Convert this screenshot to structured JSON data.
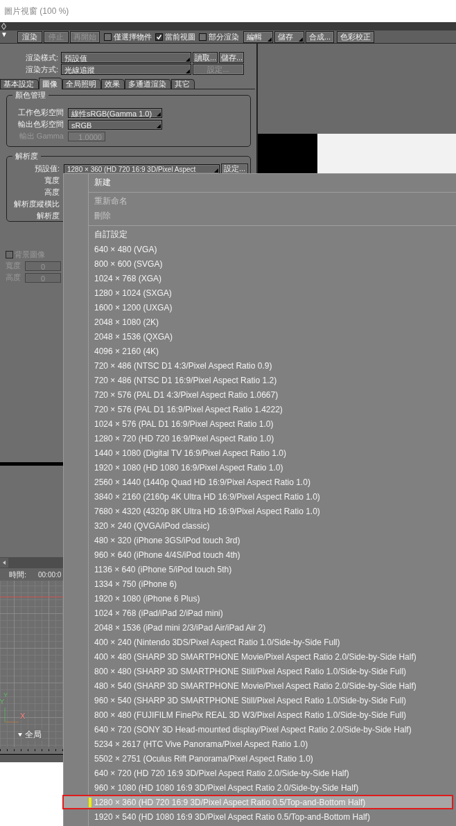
{
  "window": {
    "title": "圖片視窗 (100 %)"
  },
  "toolbar": {
    "collapse_glyph": "▼",
    "items": [
      {
        "kind": "button",
        "label": "渲染",
        "disabled": false
      },
      {
        "kind": "button",
        "label": "停止",
        "disabled": true
      },
      {
        "kind": "button",
        "label": "再開始",
        "disabled": true
      },
      {
        "kind": "checkbox",
        "label": "僅選擇物件",
        "checked": false,
        "disabled": false
      },
      {
        "kind": "checkbox",
        "label": "當前視圖",
        "checked": true,
        "disabled": false
      },
      {
        "kind": "checkbox",
        "label": "部分渲染",
        "checked": false,
        "disabled": false
      },
      {
        "kind": "dropdown",
        "label": "編輯",
        "disabled": false
      },
      {
        "kind": "dropdown",
        "label": "儲存",
        "disabled": false
      },
      {
        "kind": "button",
        "label": "合成...",
        "disabled": false
      },
      {
        "kind": "button",
        "label": "色彩校正",
        "disabled": false
      }
    ]
  },
  "render_settings": [
    {
      "label": "渲染樣式:",
      "value": "預設值",
      "buttons": [
        {
          "label": "讀取...",
          "disabled": false
        },
        {
          "label": "儲存...",
          "disabled": false
        }
      ]
    },
    {
      "label": "渲染方式:",
      "value": "光線追蹤",
      "buttons": [
        {
          "label": "設定...",
          "disabled": true
        }
      ]
    }
  ],
  "tabs": [
    {
      "label": "基本設定",
      "selected": false
    },
    {
      "label": "圖像",
      "selected": true
    },
    {
      "label": "全局照明",
      "selected": false
    },
    {
      "label": "效果",
      "selected": false
    },
    {
      "label": "多通道渲染",
      "selected": false
    },
    {
      "label": "其它",
      "selected": false
    }
  ],
  "color_management": {
    "title": "顏色管理",
    "rows": [
      {
        "kind": "dropdown",
        "label": "工作色彩空間",
        "value": "線性sRGB(Gamma 1.0)",
        "disabled": false
      },
      {
        "kind": "dropdown",
        "label": "輸出色彩空間",
        "value": "sRGB",
        "disabled": false
      },
      {
        "kind": "field",
        "label": "輸出 Gamma",
        "value": "1.0000",
        "disabled": true
      }
    ]
  },
  "resolution": {
    "title": "解析度",
    "preset": {
      "label": "預設值:",
      "value": "1280 × 360 (HD 720 16:9 3D/Pixel Aspect",
      "button": "設定..."
    },
    "labels": [
      "寬度",
      "高度",
      "解析度縱橫比",
      "解析度"
    ]
  },
  "background_image": {
    "label": "背景圖像",
    "checked": false,
    "disabled": true,
    "fields": [
      {
        "label": "寬度",
        "value": "0"
      },
      {
        "label": "高度",
        "value": "0"
      }
    ]
  },
  "timeline": {
    "time_label": "時間:",
    "time_value": "00:00:0",
    "axis_y": "Y",
    "axis_x": "X",
    "view_label": "全局"
  },
  "menu": {
    "items": [
      {
        "kind": "command",
        "label": "新建",
        "disabled": false,
        "selected": false
      },
      {
        "kind": "separator"
      },
      {
        "kind": "command",
        "label": "重新命名",
        "disabled": true,
        "selected": false
      },
      {
        "kind": "command",
        "label": "刪除",
        "disabled": true,
        "selected": false
      },
      {
        "kind": "separator"
      },
      {
        "kind": "command",
        "label": "自訂設定",
        "disabled": false,
        "selected": false
      },
      {
        "kind": "command",
        "label": "640 × 480 (VGA)",
        "disabled": false,
        "selected": false
      },
      {
        "kind": "command",
        "label": "800 × 600 (SVGA)",
        "disabled": false,
        "selected": false
      },
      {
        "kind": "command",
        "label": "1024 × 768 (XGA)",
        "disabled": false,
        "selected": false
      },
      {
        "kind": "command",
        "label": "1280 × 1024 (SXGA)",
        "disabled": false,
        "selected": false
      },
      {
        "kind": "command",
        "label": "1600 × 1200 (UXGA)",
        "disabled": false,
        "selected": false
      },
      {
        "kind": "command",
        "label": "2048 × 1080 (2K)",
        "disabled": false,
        "selected": false
      },
      {
        "kind": "command",
        "label": "2048 × 1536 (QXGA)",
        "disabled": false,
        "selected": false
      },
      {
        "kind": "command",
        "label": "4096 × 2160 (4K)",
        "disabled": false,
        "selected": false
      },
      {
        "kind": "command",
        "label": "720 × 486 (NTSC D1 4:3/Pixel Aspect Ratio 0.9)",
        "disabled": false,
        "selected": false
      },
      {
        "kind": "command",
        "label": "720 × 486 (NTSC D1 16:9/Pixel Aspect Ratio 1.2)",
        "disabled": false,
        "selected": false
      },
      {
        "kind": "command",
        "label": "720 × 576 (PAL D1 4:3/Pixel Aspect Ratio 1.0667)",
        "disabled": false,
        "selected": false
      },
      {
        "kind": "command",
        "label": "720 × 576 (PAL D1 16:9/Pixel Aspect Ratio 1.4222)",
        "disabled": false,
        "selected": false
      },
      {
        "kind": "command",
        "label": "1024 × 576 (PAL D1 16:9/Pixel Aspect Ratio 1.0)",
        "disabled": false,
        "selected": false
      },
      {
        "kind": "command",
        "label": "1280 × 720 (HD 720 16:9/Pixel Aspect Ratio 1.0)",
        "disabled": false,
        "selected": false
      },
      {
        "kind": "command",
        "label": "1440 × 1080 (Digital TV 16:9/Pixel Aspect Ratio 1.0)",
        "disabled": false,
        "selected": false
      },
      {
        "kind": "command",
        "label": "1920 × 1080 (HD 1080 16:9/Pixel Aspect Ratio 1.0)",
        "disabled": false,
        "selected": false
      },
      {
        "kind": "command",
        "label": "2560 × 1440 (1440p Quad HD 16:9/Pixel Aspect Ratio 1.0)",
        "disabled": false,
        "selected": false
      },
      {
        "kind": "command",
        "label": "3840 × 2160 (2160p 4K Ultra HD 16:9/Pixel Aspect Ratio 1.0)",
        "disabled": false,
        "selected": false
      },
      {
        "kind": "command",
        "label": "7680 × 4320 (4320p 8K Ultra HD 16:9/Pixel Aspect Ratio 1.0)",
        "disabled": false,
        "selected": false
      },
      {
        "kind": "command",
        "label": "320 × 240 (QVGA/iPod classic)",
        "disabled": false,
        "selected": false
      },
      {
        "kind": "command",
        "label": "480 × 320 (iPhone 3GS/iPod touch 3rd)",
        "disabled": false,
        "selected": false
      },
      {
        "kind": "command",
        "label": "960 × 640 (iPhone 4/4S/iPod touch 4th)",
        "disabled": false,
        "selected": false
      },
      {
        "kind": "command",
        "label": "1136 × 640 (iPhone 5/iPod touch 5th)",
        "disabled": false,
        "selected": false
      },
      {
        "kind": "command",
        "label": "1334 × 750 (iPhone 6)",
        "disabled": false,
        "selected": false
      },
      {
        "kind": "command",
        "label": "1920 × 1080 (iPhone 6 Plus)",
        "disabled": false,
        "selected": false
      },
      {
        "kind": "command",
        "label": "1024 × 768 (iPad/iPad 2/iPad mini)",
        "disabled": false,
        "selected": false
      },
      {
        "kind": "command",
        "label": "2048 × 1536 (iPad mini 2/3/iPad Air/iPad Air 2)",
        "disabled": false,
        "selected": false
      },
      {
        "kind": "command",
        "label": "400 × 240 (Nintendo 3DS/Pixel Aspect Ratio 1.0/Side-by-Side Full)",
        "disabled": false,
        "selected": false
      },
      {
        "kind": "command",
        "label": "400 × 480 (SHARP 3D SMARTPHONE Movie/Pixel Aspect Ratio 2.0/Side-by-Side Half)",
        "disabled": false,
        "selected": false
      },
      {
        "kind": "command",
        "label": "800 × 480 (SHARP 3D SMARTPHONE Still/Pixel Aspect Ratio 1.0/Side-by-Side Full)",
        "disabled": false,
        "selected": false
      },
      {
        "kind": "command",
        "label": "480 × 540 (SHARP 3D SMARTPHONE Movie/Pixel Aspect Ratio 2.0/Side-by-Side Half)",
        "disabled": false,
        "selected": false
      },
      {
        "kind": "command",
        "label": "960 × 540 (SHARP 3D SMARTPHONE Still/Pixel Aspect Ratio 1.0/Side-by-Side Full)",
        "disabled": false,
        "selected": false
      },
      {
        "kind": "command",
        "label": "800 × 480 (FUJIFILM FinePix REAL 3D W3/Pixel Aspect Ratio 1.0/Side-by-Side Full)",
        "disabled": false,
        "selected": false
      },
      {
        "kind": "command",
        "label": "640 × 720 (SONY 3D Head-mounted display/Pixel Aspect Ratio 2.0/Side-by-Side Half)",
        "disabled": false,
        "selected": false
      },
      {
        "kind": "command",
        "label": "5234 × 2617 (HTC Vive Panorama/Pixel Aspect Ratio 1.0)",
        "disabled": false,
        "selected": false
      },
      {
        "kind": "command",
        "label": "5502 × 2751 (Oculus Rift Panorama/Pixel Aspect Ratio 1.0)",
        "disabled": false,
        "selected": false
      },
      {
        "kind": "command",
        "label": "640 × 720 (HD 720 16:9 3D/Pixel Aspect Ratio 2.0/Side-by-Side Half)",
        "disabled": false,
        "selected": false
      },
      {
        "kind": "command",
        "label": "960 × 1080 (HD 1080 16:9 3D/Pixel Aspect Ratio 2.0/Side-by-Side Half)",
        "disabled": false,
        "selected": false
      },
      {
        "kind": "command",
        "label": "1280 × 360 (HD 720 16:9 3D/Pixel Aspect Ratio 0.5/Top-and-Bottom Half)",
        "disabled": false,
        "selected": true
      },
      {
        "kind": "command",
        "label": "1920 × 540 (HD 1080 16:9 3D/Pixel Aspect Ratio 0.5/Top-and-Bottom Half)",
        "disabled": false,
        "selected": false
      }
    ]
  }
}
